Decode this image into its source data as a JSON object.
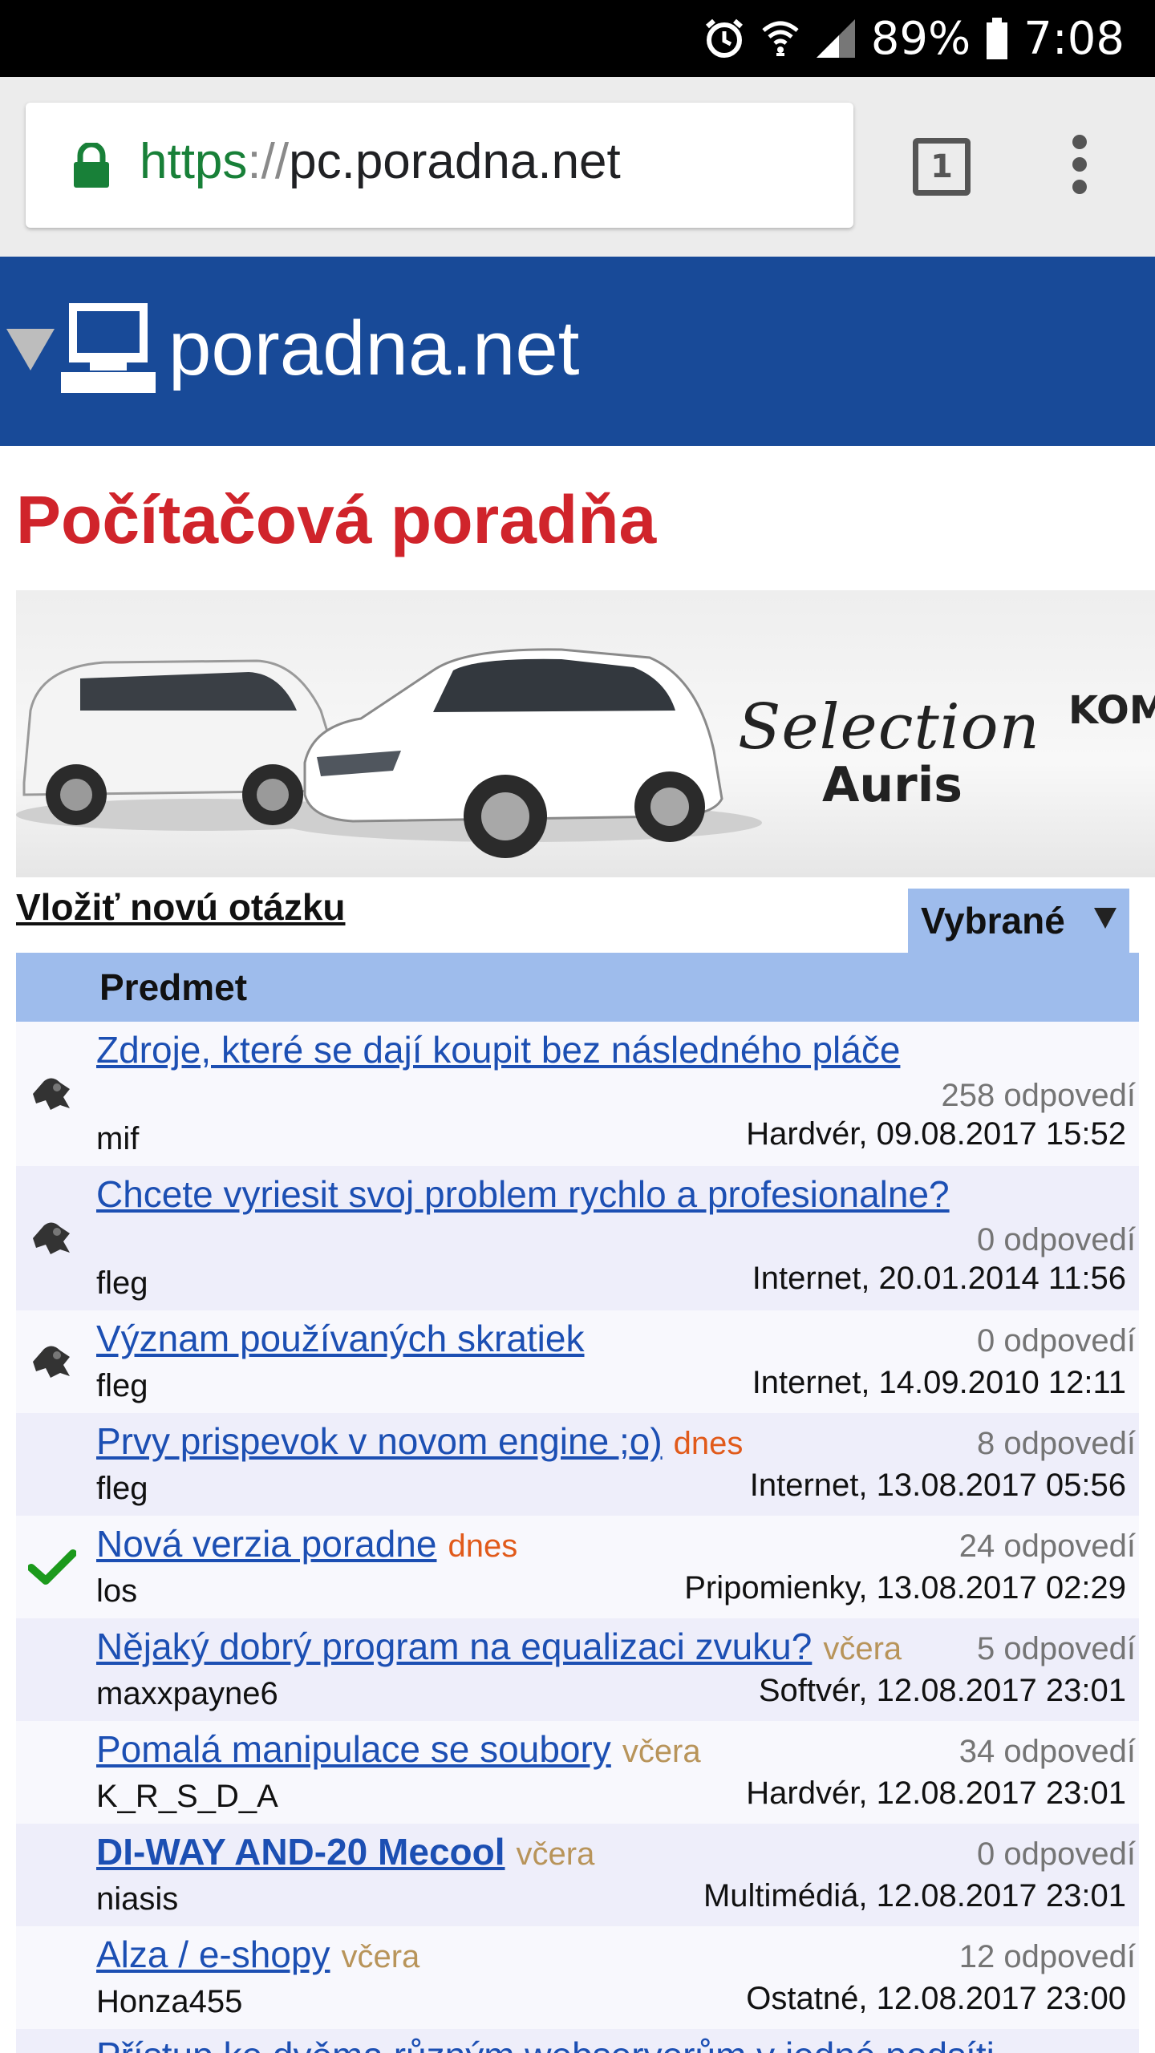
{
  "status_bar": {
    "battery": "89%",
    "time": "7:08",
    "icons": [
      "alarm-icon",
      "wifi-icon",
      "signal-icon",
      "battery-icon"
    ]
  },
  "browser": {
    "url_protocol": "https",
    "url_separator": "://",
    "url_host": "pc.poradna.net",
    "tab_count": "1",
    "icons": [
      "lock-icon",
      "tabs-icon",
      "overflow-menu-icon"
    ]
  },
  "site": {
    "name": "poradna.net",
    "header_color": "#184a98"
  },
  "page": {
    "title": "Počítačová poradňa",
    "title_color": "#d0242b"
  },
  "banner": {
    "script_text": "Selection",
    "model_text": "Auris",
    "cut_text": "KOM"
  },
  "actions": {
    "new_question_label": "Vložiť novú otázku",
    "filter_selected": "Vybrané"
  },
  "table": {
    "header_subject": "Predmet",
    "header_color": "#9ebcec",
    "rows": [
      {
        "title": "Zdroje, které se dají koupit bez následného pláče",
        "replies": "258 odpovedí",
        "author": "mif",
        "meta": "Hardvér, 09.08.2017 15:52",
        "marker": "pin-icon",
        "badge": "",
        "bold": false
      },
      {
        "title": "Chcete vyriesit svoj problem rychlo a profesionalne?",
        "replies": "0 odpovedí",
        "author": "fleg",
        "meta": "Internet, 20.01.2014 11:56",
        "marker": "pin-icon",
        "badge": "",
        "bold": false
      },
      {
        "title": "Význam používaných skratiek",
        "replies": "0 odpovedí",
        "author": "fleg",
        "meta": "Internet, 14.09.2010 12:11",
        "marker": "pin-icon",
        "badge": "",
        "bold": false
      },
      {
        "title": "Prvy prispevok v novom engine ;o)",
        "replies": "8 odpovedí",
        "author": "fleg",
        "meta": "Internet, 13.08.2017 05:56",
        "marker": "",
        "badge": "dnes",
        "bold": false
      },
      {
        "title": "Nová verzia poradne",
        "replies": "24 odpovedí",
        "author": "los",
        "meta": "Pripomienky, 13.08.2017 02:29",
        "marker": "check-icon",
        "badge": "dnes",
        "bold": false
      },
      {
        "title": "Nějaký dobrý program na equalizaci zvuku?",
        "replies": "5 odpovedí",
        "author": "maxxpayne6",
        "meta": "Softvér, 12.08.2017 23:01",
        "marker": "",
        "badge": "včera",
        "bold": false
      },
      {
        "title": "Pomalá manipulace se soubory",
        "replies": "34 odpovedí",
        "author": "K_R_S_D_A",
        "meta": "Hardvér, 12.08.2017 23:01",
        "marker": "",
        "badge": "včera",
        "bold": false
      },
      {
        "title": "DI-WAY AND-20 Mecool",
        "replies": "0 odpovedí",
        "author": "niasis",
        "meta": "Multimédiá, 12.08.2017 23:01",
        "marker": "",
        "badge": "včera",
        "bold": true
      },
      {
        "title": "Alza / e-shopy",
        "replies": "12 odpovedí",
        "author": "Honza455",
        "meta": "Ostatné, 12.08.2017 23:00",
        "marker": "",
        "badge": "včera",
        "bold": false
      },
      {
        "title": "Přístup ke dvěma různým webserverům v jedné podsíti",
        "replies": "",
        "author": "",
        "meta": "",
        "marker": "",
        "badge": "",
        "bold": false
      }
    ]
  }
}
